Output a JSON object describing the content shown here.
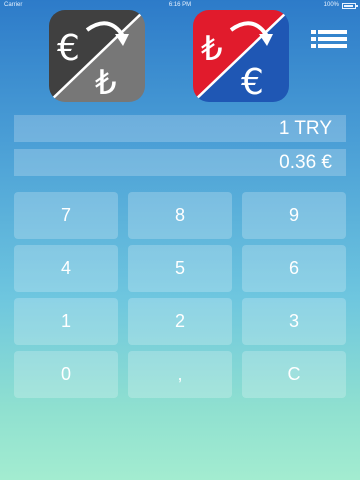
{
  "status_bar": {
    "carrier": "Carrier",
    "time": "6:16 PM",
    "battery": "100%"
  },
  "modes": {
    "eur_to_try": {
      "icon": "euro-to-lira-icon",
      "color_dark": "#3f3f3f",
      "color_light": "#7a7a7a"
    },
    "try_to_eur": {
      "icon": "lira-to-euro-icon",
      "color_red": "#e21a2a",
      "color_blue": "#1f58b5"
    }
  },
  "menu": {
    "icon": "list-menu-icon"
  },
  "display": {
    "input": "1 TRY",
    "result": "0.36 €"
  },
  "keypad": {
    "k7": "7",
    "k8": "8",
    "k9": "9",
    "k4": "4",
    "k5": "5",
    "k6": "6",
    "k1": "1",
    "k2": "2",
    "k3": "3",
    "k0": "0",
    "kdec": ",",
    "kclear": "C"
  }
}
